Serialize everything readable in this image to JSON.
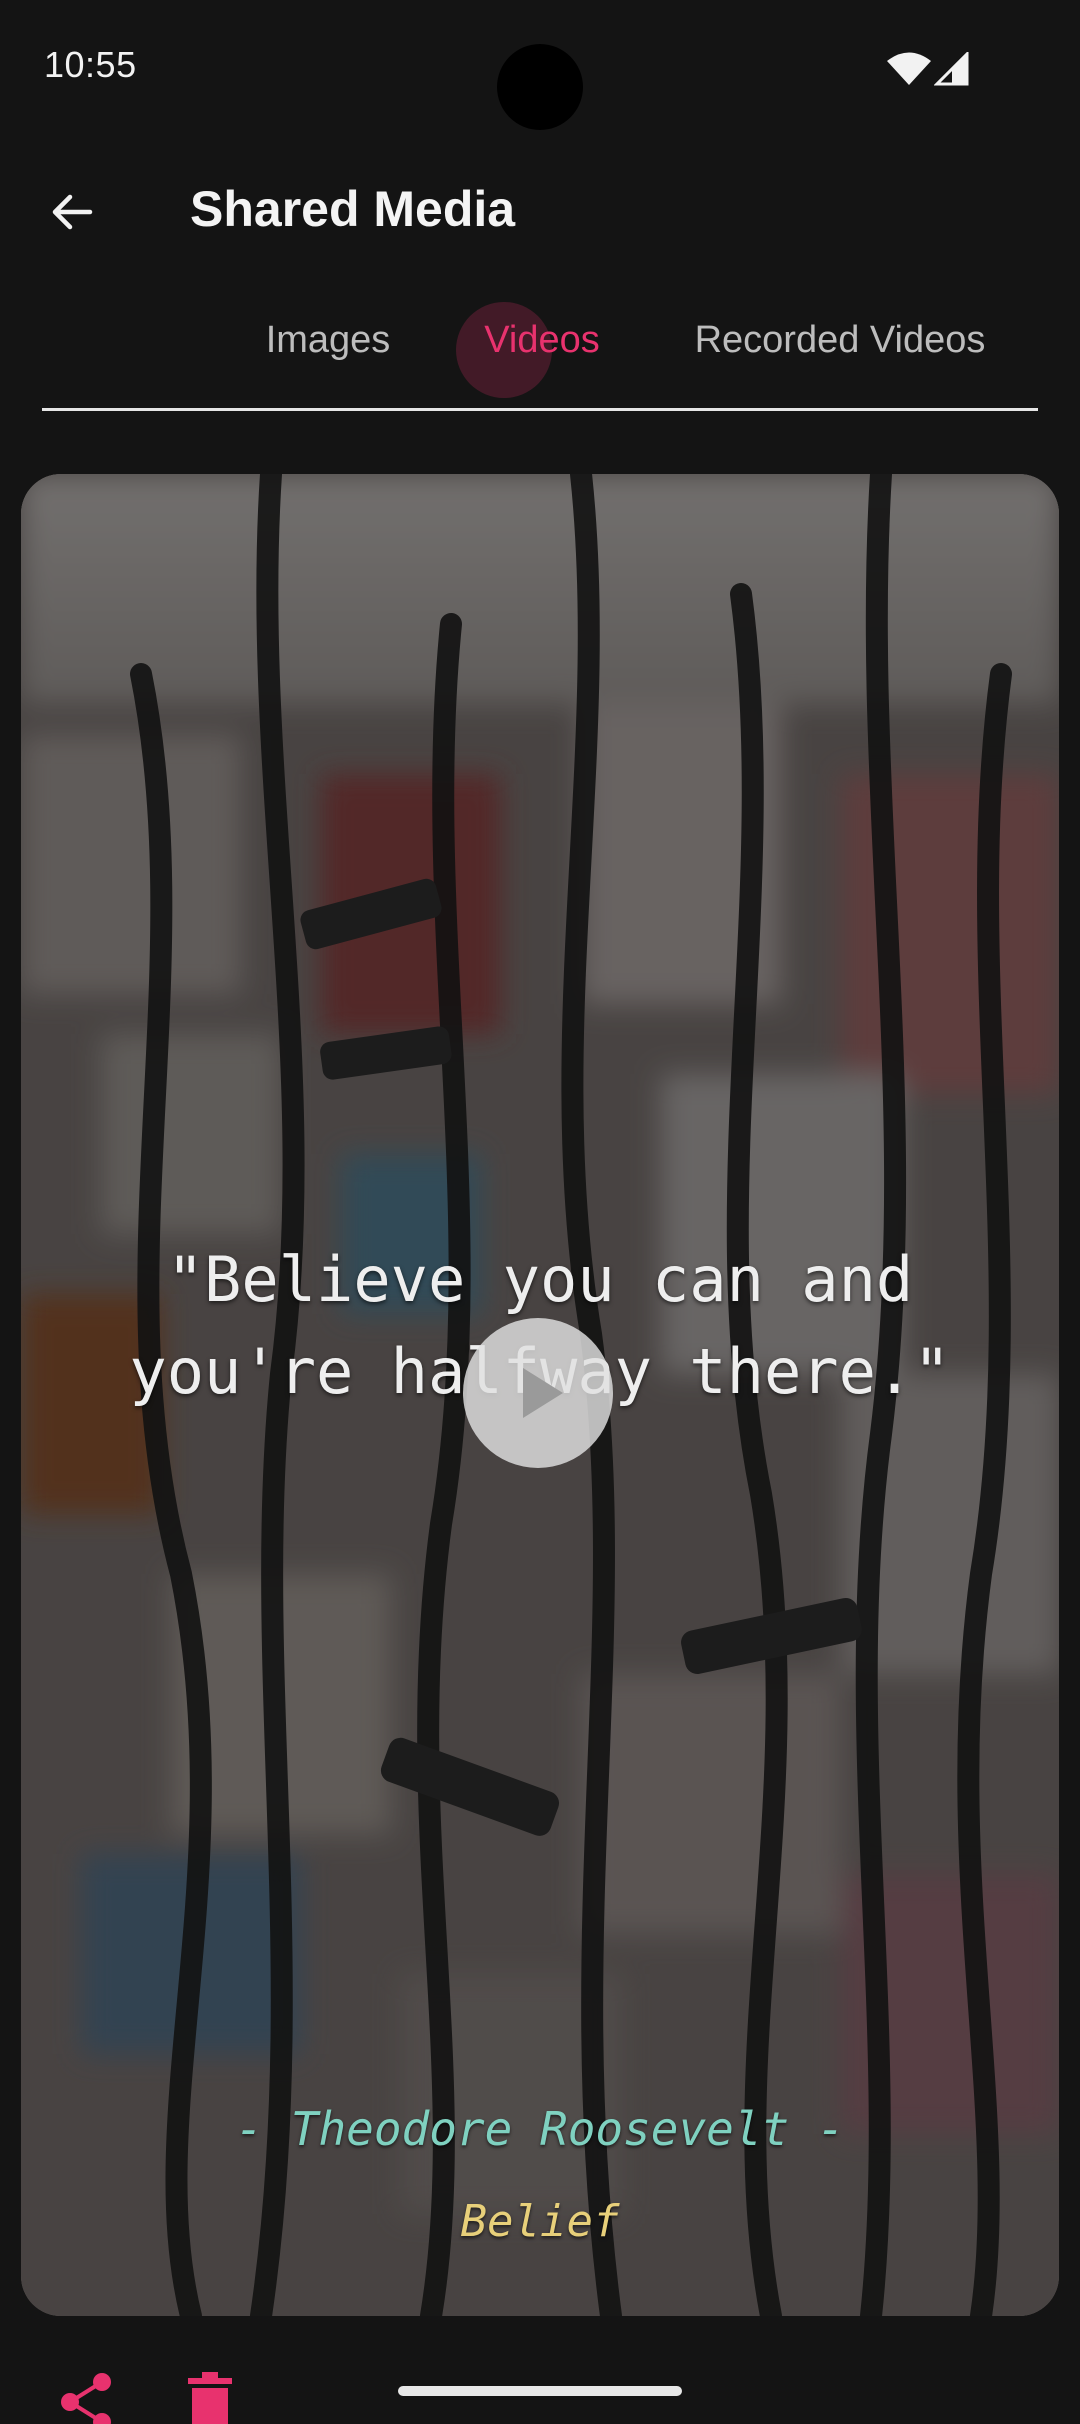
{
  "status_bar": {
    "time": "10:55",
    "icons": [
      "wifi-icon",
      "cellular-signal-icon"
    ]
  },
  "app_bar": {
    "back_icon": "arrow-left-icon",
    "title": "Shared Media"
  },
  "tabs": [
    {
      "label": "Images",
      "selected": false
    },
    {
      "label": "Videos",
      "selected": true
    },
    {
      "label": "Recorded Videos",
      "selected": false
    }
  ],
  "media": {
    "quote_line": "\"Believe you can and\nyou're halfway there.\"",
    "author": "- Theodore Roosevelt -",
    "tag": "Belief",
    "play_icon": "play-icon"
  },
  "actions": {
    "share_icon": "share-icon",
    "delete_icon": "trash-icon"
  },
  "colors": {
    "background": "#141414",
    "accent": "#e8326e",
    "text_primary": "#f4f4f4",
    "text_secondary": "#bdbdbd"
  }
}
